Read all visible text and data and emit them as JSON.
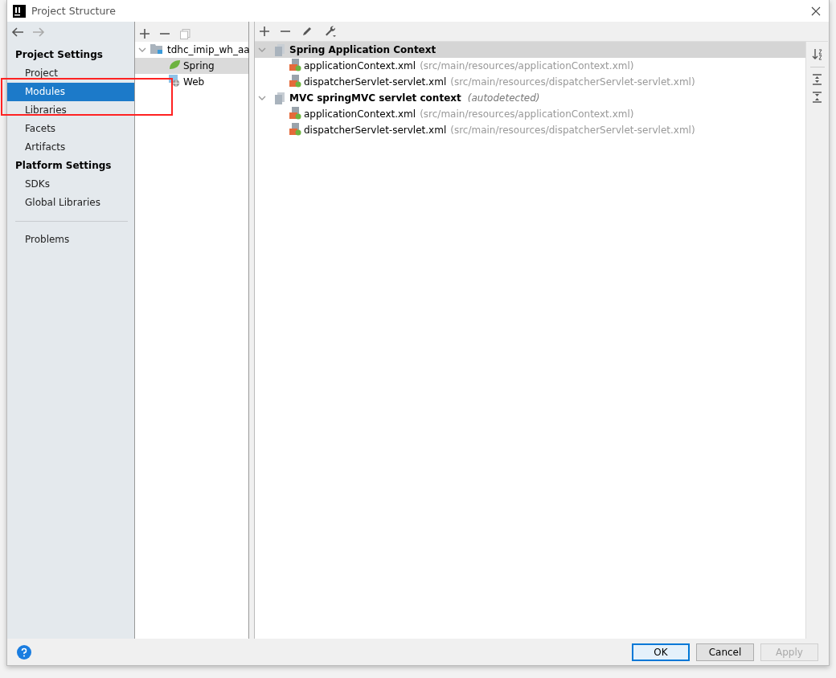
{
  "window": {
    "title": "Project Structure"
  },
  "sidebar": {
    "sections": [
      {
        "title": "Project Settings",
        "items": [
          {
            "label": "Project",
            "selected": false
          },
          {
            "label": "Modules",
            "selected": true
          },
          {
            "label": "Libraries",
            "selected": false
          },
          {
            "label": "Facets",
            "selected": false
          },
          {
            "label": "Artifacts",
            "selected": false
          }
        ]
      },
      {
        "title": "Platform Settings",
        "items": [
          {
            "label": "SDKs",
            "selected": false
          },
          {
            "label": "Global Libraries",
            "selected": false
          }
        ]
      }
    ],
    "bottom_items": [
      {
        "label": "Problems",
        "selected": false
      }
    ]
  },
  "module_tree": {
    "root": {
      "label": "tdhc_imip_wh_aa",
      "expanded": true,
      "children": [
        {
          "label": "Spring",
          "kind": "spring",
          "selected": true
        },
        {
          "label": "Web",
          "kind": "web",
          "selected": false
        }
      ]
    }
  },
  "contexts": [
    {
      "label": "Spring Application Context",
      "expanded": true,
      "selected": true,
      "files": [
        {
          "name": "applicationContext.xml",
          "path": "(src/main/resources/applicationContext.xml)"
        },
        {
          "name": "dispatcherServlet-servlet.xml",
          "path": "(src/main/resources/dispatcherServlet-servlet.xml)"
        }
      ]
    },
    {
      "label": "MVC springMVC servlet context",
      "note": "(autodetected)",
      "expanded": true,
      "selected": false,
      "files": [
        {
          "name": "applicationContext.xml",
          "path": "(src/main/resources/applicationContext.xml)"
        },
        {
          "name": "dispatcherServlet-servlet.xml",
          "path": "(src/main/resources/dispatcherServlet-servlet.xml)"
        }
      ]
    }
  ],
  "buttons": [
    {
      "label": "OK",
      "kind": "default",
      "disabled": false
    },
    {
      "label": "Cancel",
      "kind": "normal",
      "disabled": false
    },
    {
      "label": "Apply",
      "kind": "normal",
      "disabled": true
    }
  ]
}
